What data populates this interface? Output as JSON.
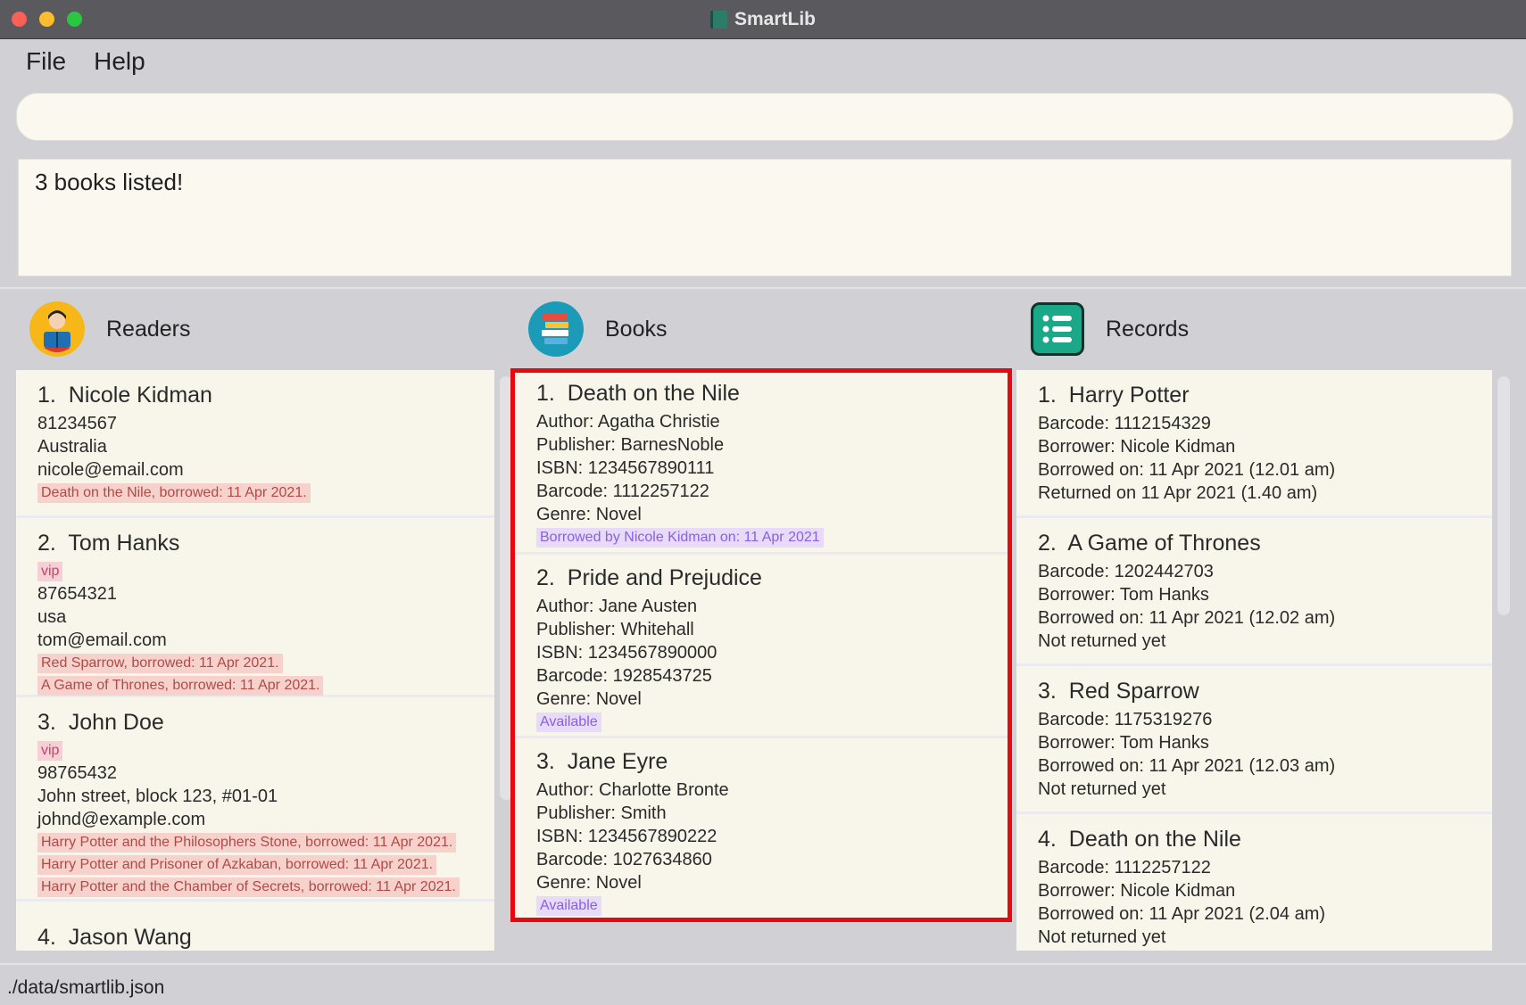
{
  "window": {
    "title": "SmartLib"
  },
  "menu": {
    "file": "File",
    "help": "Help"
  },
  "command": {
    "value": "",
    "placeholder": ""
  },
  "result": {
    "message": "3 books listed!"
  },
  "panels": {
    "readers": {
      "title": "Readers",
      "items": [
        {
          "index": "1.",
          "name": "Nicole Kidman",
          "tags": [],
          "phone": "81234567",
          "address": "Australia",
          "email": "nicole@email.com",
          "borrowed": [
            "Death on the Nile, borrowed: 11 Apr 2021."
          ]
        },
        {
          "index": "2.",
          "name": "Tom Hanks",
          "tags": [
            "vip"
          ],
          "phone": "87654321",
          "address": "usa",
          "email": "tom@email.com",
          "borrowed": [
            "Red Sparrow, borrowed: 11 Apr 2021.",
            "A Game of Thrones, borrowed: 11 Apr 2021."
          ]
        },
        {
          "index": "3.",
          "name": "John Doe",
          "tags": [
            "vip"
          ],
          "phone": "98765432",
          "address": "John street, block 123, #01-01",
          "email": "johnd@example.com",
          "borrowed": [
            "Harry Potter and the Philosophers Stone, borrowed: 11 Apr 2021.",
            "Harry Potter and Prisoner of Azkaban, borrowed: 11 Apr 2021.",
            "Harry Potter and the Chamber of Secrets, borrowed: 11 Apr 2021."
          ]
        },
        {
          "index": "4.",
          "name": "Jason Wang"
        }
      ]
    },
    "books": {
      "title": "Books",
      "items": [
        {
          "index": "1.",
          "name": "Death on the Nile",
          "author": "Author: Agatha Christie",
          "publisher": "Publisher: BarnesNoble",
          "isbn": "ISBN: 1234567890111",
          "barcode": "Barcode: 1112257122",
          "genre": "Genre: Novel",
          "status": "Borrowed by Nicole Kidman on: 11 Apr 2021"
        },
        {
          "index": "2.",
          "name": "Pride and Prejudice",
          "author": "Author: Jane Austen",
          "publisher": "Publisher: Whitehall",
          "isbn": "ISBN: 1234567890000",
          "barcode": "Barcode: 1928543725",
          "genre": "Genre: Novel",
          "status": "Available"
        },
        {
          "index": "3.",
          "name": "Jane Eyre",
          "author": "Author: Charlotte Bronte",
          "publisher": "Publisher: Smith",
          "isbn": "ISBN: 1234567890222",
          "barcode": "Barcode: 1027634860",
          "genre": "Genre: Novel",
          "status": "Available"
        }
      ]
    },
    "records": {
      "title": "Records",
      "items": [
        {
          "index": "1.",
          "name": "Harry Potter",
          "barcode": "Barcode: 1112154329",
          "borrower": "Borrower: Nicole Kidman",
          "borrowed_on": "Borrowed on: 11 Apr 2021 (12.01 am)",
          "returned": "Returned on 11 Apr 2021 (1.40 am)"
        },
        {
          "index": "2.",
          "name": "A Game of Thrones",
          "barcode": "Barcode: 1202442703",
          "borrower": "Borrower: Tom Hanks",
          "borrowed_on": "Borrowed on: 11 Apr 2021 (12.02 am)",
          "returned": "Not returned yet"
        },
        {
          "index": "3.",
          "name": "Red Sparrow",
          "barcode": "Barcode: 1175319276",
          "borrower": "Borrower: Tom Hanks",
          "borrowed_on": "Borrowed on: 11 Apr 2021 (12.03 am)",
          "returned": "Not returned yet"
        },
        {
          "index": "4.",
          "name": "Death on the Nile",
          "barcode": "Barcode: 1112257122",
          "borrower": "Borrower: Nicole Kidman",
          "borrowed_on": "Borrowed on: 11 Apr 2021 (2.04 am)",
          "returned": "Not returned yet"
        }
      ]
    }
  },
  "status": {
    "path": "./data/smartlib.json"
  },
  "colors": {
    "highlight": "#e60a10",
    "borrowed_tag": "#f7d2cc",
    "status_tag": "#e7dbf9"
  }
}
